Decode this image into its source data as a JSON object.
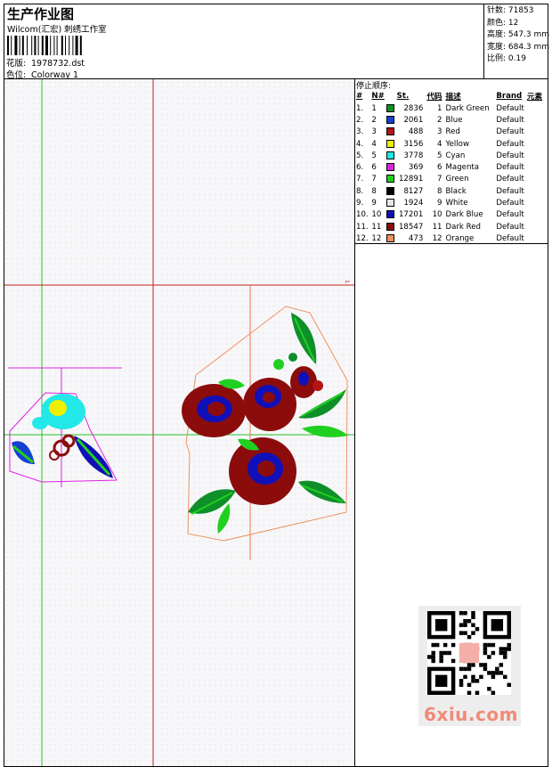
{
  "header": {
    "title": "生产作业图",
    "subtitle": "Wilcom(汇宏) 刺绣工作室",
    "design_label": "花版:",
    "design_value": "1978732.dst",
    "colorway_label": "色位:",
    "colorway_value": "Colorway 1"
  },
  "stats": {
    "stitches": "针数: 71853",
    "colors": "颜色: 12",
    "height": "高度: 547.3 mm",
    "width": "宽度: 684.3 mm",
    "scale": "比例: 0.19"
  },
  "sequence": {
    "title": "停止顺序:",
    "headers": [
      "#",
      "N#",
      "St.",
      "代码",
      "描述",
      "Brand",
      "元素"
    ],
    "rows": [
      {
        "idx": "1.",
        "n": "1",
        "color": "#0f8f2a",
        "st": "2836",
        "code": "1",
        "desc": "Dark Green",
        "brand": "Default"
      },
      {
        "idx": "2.",
        "n": "2",
        "color": "#1540d0",
        "st": "2061",
        "code": "2",
        "desc": "Blue",
        "brand": "Default"
      },
      {
        "idx": "3.",
        "n": "3",
        "color": "#b41414",
        "st": "488",
        "code": "3",
        "desc": "Red",
        "brand": "Default"
      },
      {
        "idx": "4.",
        "n": "4",
        "color": "#f0f000",
        "st": "3156",
        "code": "4",
        "desc": "Yellow",
        "brand": "Default"
      },
      {
        "idx": "5.",
        "n": "5",
        "color": "#22e8e8",
        "st": "3778",
        "code": "5",
        "desc": "Cyan",
        "brand": "Default"
      },
      {
        "idx": "6.",
        "n": "6",
        "color": "#e020e0",
        "st": "369",
        "code": "6",
        "desc": "Magenta",
        "brand": "Default"
      },
      {
        "idx": "7.",
        "n": "7",
        "color": "#20d020",
        "st": "12891",
        "code": "7",
        "desc": "Green",
        "brand": "Default"
      },
      {
        "idx": "8.",
        "n": "8",
        "color": "#000000",
        "st": "8127",
        "code": "8",
        "desc": "Black",
        "brand": "Default"
      },
      {
        "idx": "9.",
        "n": "9",
        "color": "#e8e8e8",
        "st": "1924",
        "code": "9",
        "desc": "White",
        "brand": "Default"
      },
      {
        "idx": "10.",
        "n": "10",
        "color": "#1010b8",
        "st": "17201",
        "code": "10",
        "desc": "Dark Blue",
        "brand": "Default"
      },
      {
        "idx": "11.",
        "n": "11",
        "color": "#8c0c0c",
        "st": "18547",
        "code": "11",
        "desc": "Dark Red",
        "brand": "Default"
      },
      {
        "idx": "12.",
        "n": "12",
        "color": "#f09060",
        "st": "473",
        "code": "12",
        "desc": "Orange",
        "brand": "Default"
      }
    ]
  },
  "watermark": {
    "text": "6xiu.com",
    "qr_icon": "qr-code-icon"
  }
}
